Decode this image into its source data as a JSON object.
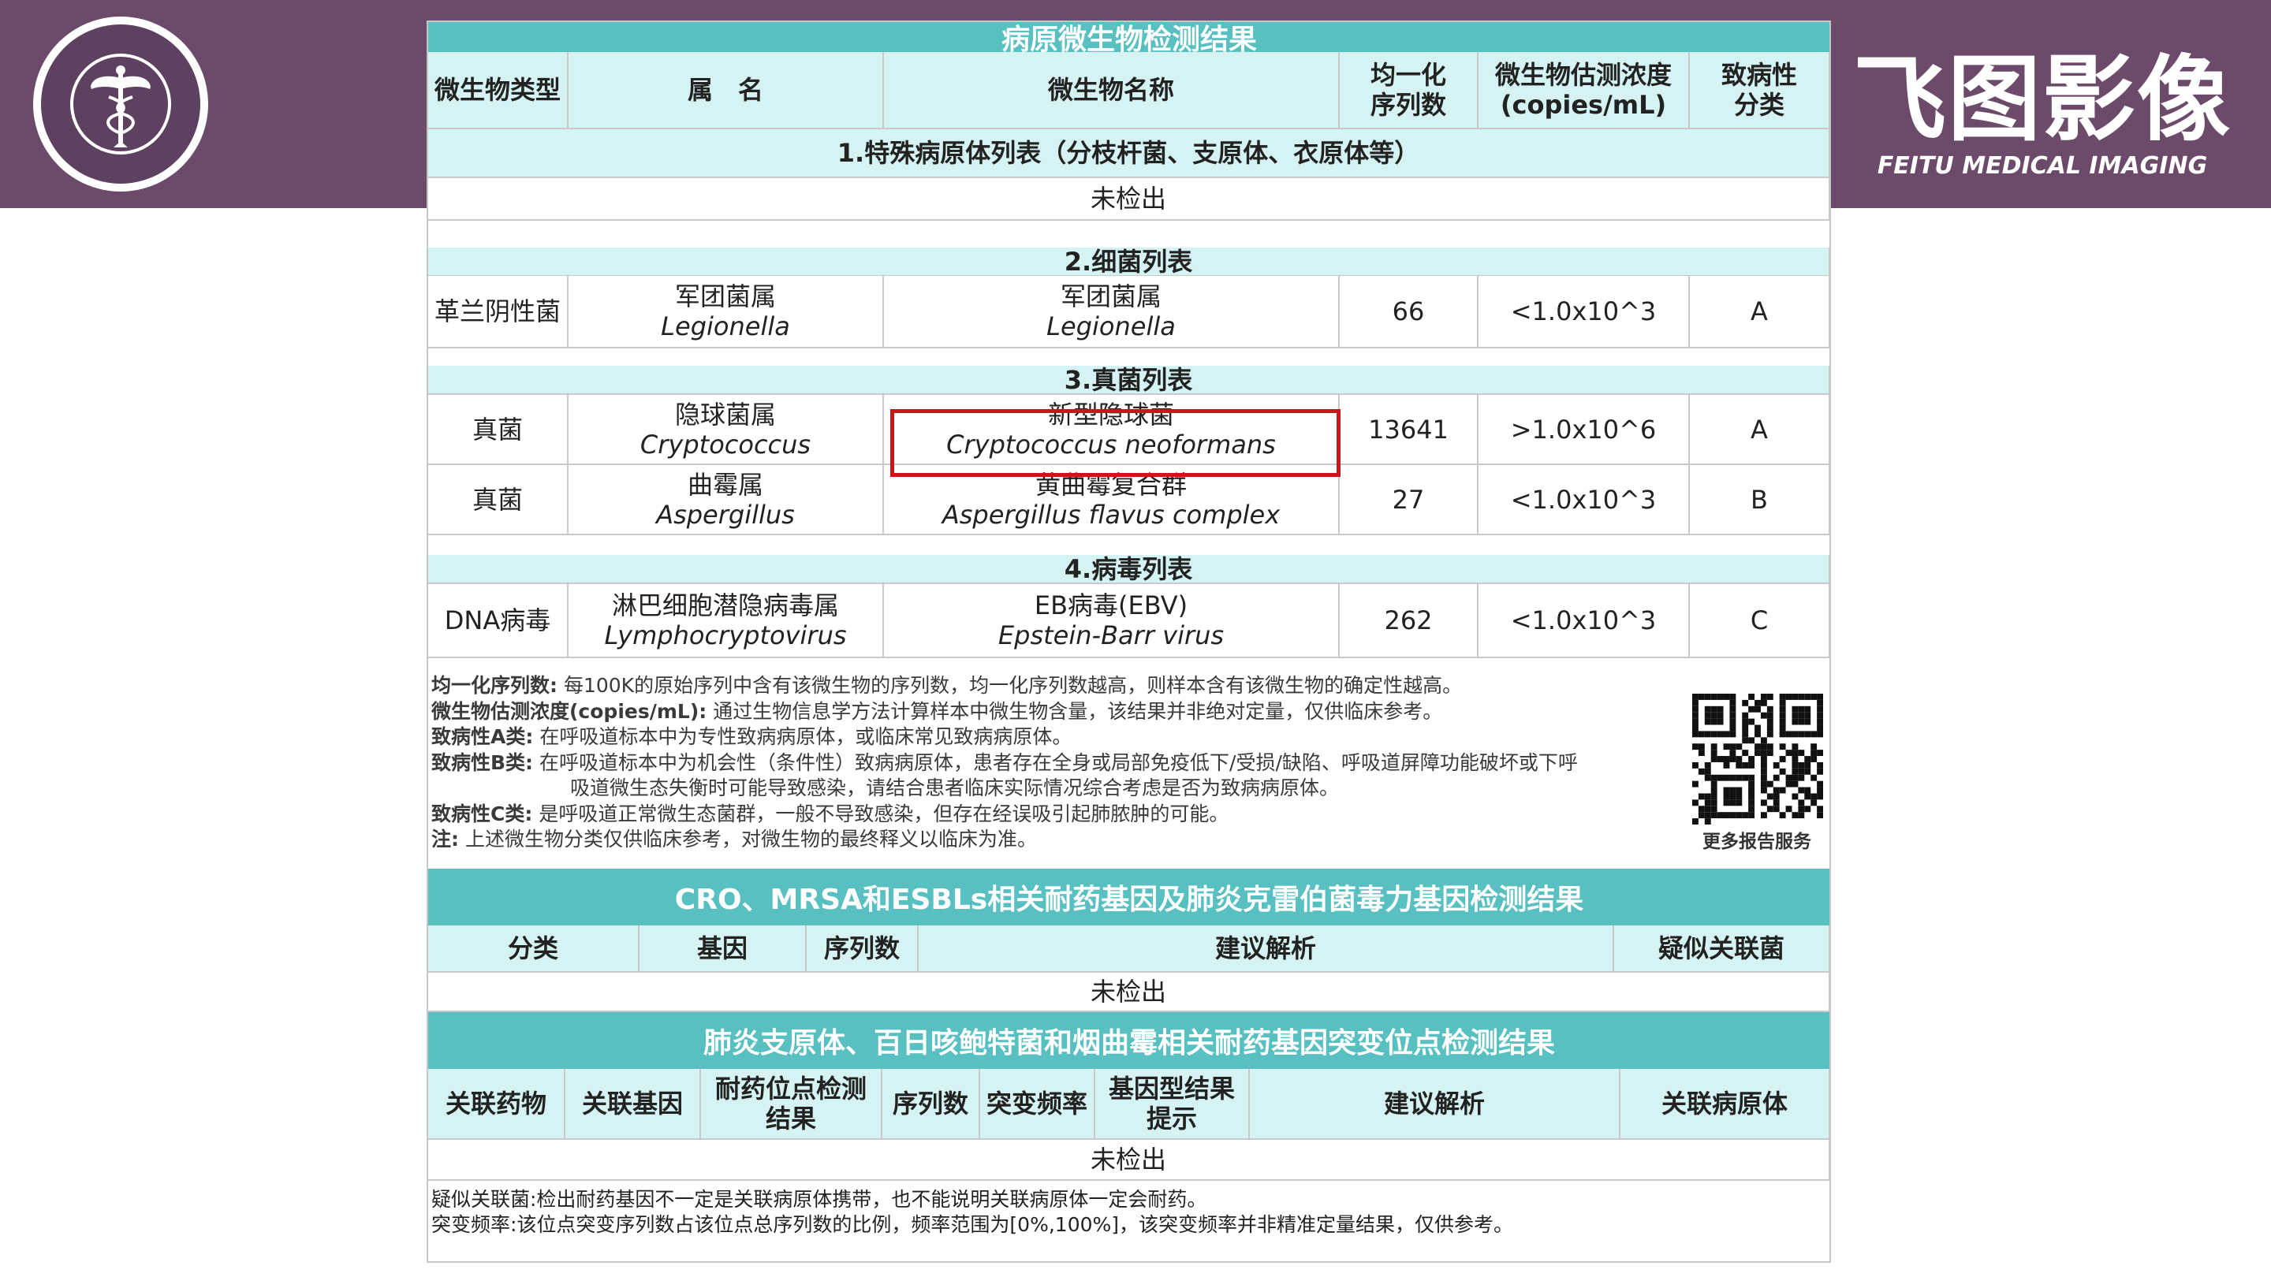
{
  "brand": {
    "name_cn": "飞图影像",
    "name_en": "FEITU MEDICAL IMAGING"
  },
  "report": {
    "title": "病原微生物检测结果",
    "columns": [
      "微生物类型",
      "属　名",
      "微生物名称",
      "均一化\n序列数",
      "微生物估测浓度\n(copies/mL)",
      "致病性\n分类"
    ],
    "sections": [
      {
        "title": "1.特殊病原体列表（分枝杆菌、支原体、衣原体等）",
        "empty": "未检出",
        "rows": []
      },
      {
        "title": "2.细菌列表",
        "rows": [
          {
            "type": "革兰阴性菌",
            "genus_cn": "军团菌属",
            "genus_lat": "Legionella",
            "species_cn": "军团菌属",
            "species_lat": "Legionella",
            "reads": "66",
            "conc": "<1.0x10^3",
            "class": "A"
          }
        ]
      },
      {
        "title": "3.真菌列表",
        "rows": [
          {
            "type": "真菌",
            "genus_cn": "隐球菌属",
            "genus_lat": "Cryptococcus",
            "species_cn": "新型隐球菌",
            "species_lat": "Cryptococcus neoformans",
            "reads": "13641",
            "conc": ">1.0x10^6",
            "class": "A"
          },
          {
            "type": "真菌",
            "genus_cn": "曲霉属",
            "genus_lat": "Aspergillus",
            "species_cn": "黄曲霉复合群",
            "species_lat": "Aspergillus flavus complex",
            "reads": "27",
            "conc": "<1.0x10^3",
            "class": "B"
          }
        ]
      },
      {
        "title": "4.病毒列表",
        "rows": [
          {
            "type": "DNA病毒",
            "genus_cn": "淋巴细胞潜隐病毒属",
            "genus_lat": "Lymphocryptovirus",
            "species_cn": "EB病毒(EBV)",
            "species_lat": "Epstein-Barr virus",
            "reads": "262",
            "conc": "<1.0x10^3",
            "class": "C"
          }
        ]
      }
    ],
    "notes": [
      {
        "key": "均一化序列数:",
        "text": "每100K的原始序列中含有该微生物的序列数，均一化序列数越高，则样本含有该微生物的确定性越高。"
      },
      {
        "key": "微生物估测浓度(copies/mL):",
        "text": "通过生物信息学方法计算样本中微生物含量，该结果并非绝对定量，仅供临床参考。"
      },
      {
        "key": "致病性A类:",
        "text": "在呼吸道标本中为专性致病病原体，或临床常见致病病原体。"
      },
      {
        "key": "致病性B类:",
        "text": "在呼吸道标本中为机会性（条件性）致病病原体，患者存在全身或局部免疫低下/受损/缺陷、呼吸道屏障功能破坏或下呼"
      },
      {
        "key": "",
        "text": "吸道微生态失衡时可能导致感染，请结合患者临床实际情况综合考虑是否为致病病原体。"
      },
      {
        "key": "致病性C类:",
        "text": "是呼吸道正常微生态菌群，一般不导致感染，但存在经误吸引起肺脓肿的可能。"
      },
      {
        "key": "注:",
        "text": "上述微生物分类仅供临床参考，对微生物的最终释义以临床为准。"
      }
    ],
    "qr_label": "更多报告服务",
    "resistance": {
      "title": "CRO、MRSA和ESBLs相关耐药基因及肺炎克雷伯菌毒力基因检测结果",
      "columns": [
        "分类",
        "基因",
        "序列数",
        "建议解析",
        "疑似关联菌"
      ],
      "empty": "未检出"
    },
    "mutation": {
      "title": "肺炎支原体、百日咳鲍特菌和烟曲霉相关耐药基因突变位点检测结果",
      "columns": [
        "关联药物",
        "关联基因",
        "耐药位点检测\n结果",
        "序列数",
        "突变频率",
        "基因型结果\n提示",
        "建议解析",
        "关联病原体"
      ],
      "empty": "未检出"
    },
    "footnotes": [
      "疑似关联菌:检出耐药基因不一定是关联病原体携带，也不能说明关联病原体一定会耐药。",
      "突变频率:该位点突变序列数占该位点总序列数的比例，频率范围为[0%,100%]，该突变频率并非精准定量结果，仅供参考。"
    ]
  },
  "colors": {
    "band": "#6b4b69",
    "teal_title": "#58c0c0",
    "teal_light": "#d6f3f4",
    "highlight": "#c8171b"
  }
}
